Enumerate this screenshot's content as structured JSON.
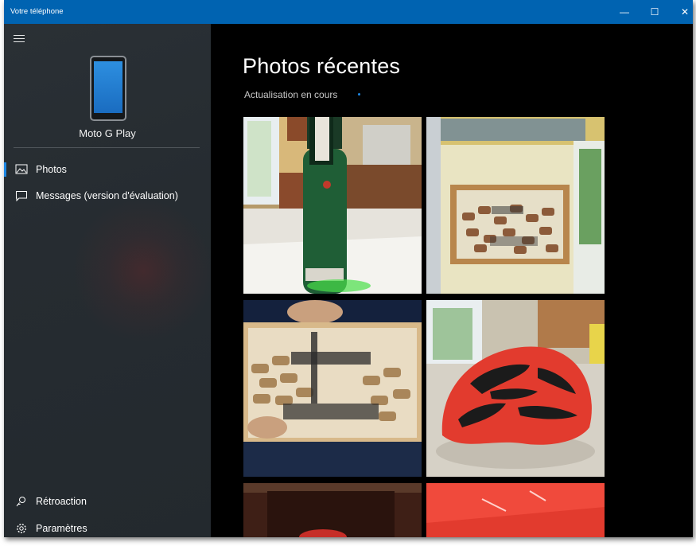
{
  "window": {
    "title": "Votre téléphone",
    "controls": {
      "minimize": "—",
      "maximize": "☐",
      "close": "✕"
    }
  },
  "sidebar": {
    "device_name": "Moto G Play",
    "items": [
      {
        "label": "Photos",
        "icon": "photos-icon",
        "active": true
      },
      {
        "label": "Messages (version d'évaluation)",
        "icon": "message-icon",
        "active": false
      }
    ],
    "footer": [
      {
        "label": "Rétroaction",
        "icon": "feedback-icon"
      },
      {
        "label": "Paramètres",
        "icon": "gear-icon"
      }
    ]
  },
  "main": {
    "title": "Photos récentes",
    "status": "Actualisation en cours"
  },
  "photos": [
    {
      "name": "photo-champagne-bottle"
    },
    {
      "name": "photo-cork-frame-wall"
    },
    {
      "name": "photo-cork-frame-held"
    },
    {
      "name": "photo-red-bike-helmet"
    },
    {
      "name": "photo-dark-interior"
    },
    {
      "name": "photo-red-surface"
    }
  ],
  "colors": {
    "titlebar": "#0063b1",
    "accent": "#1e88e5",
    "sidebar_bg": "#262c31",
    "main_bg": "#000000"
  }
}
